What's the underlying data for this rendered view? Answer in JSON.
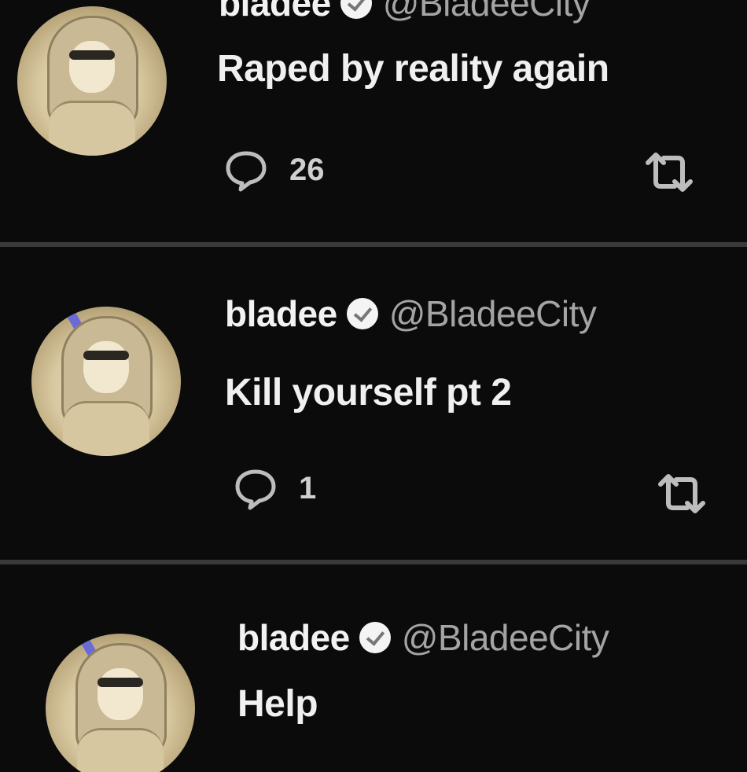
{
  "tweets": [
    {
      "name": "bladee",
      "handle": "@BladeeCity",
      "text": "Raped by reality again",
      "reply_count": "26"
    },
    {
      "name": "bladee",
      "handle": "@BladeeCity",
      "text": "Kill yourself pt 2",
      "reply_count": "1"
    },
    {
      "name": "bladee",
      "handle": "@BladeeCity",
      "text": "Help"
    }
  ],
  "icons": {
    "verified": "verified-badge-icon",
    "reply": "reply-icon",
    "retweet": "retweet-icon"
  },
  "colors": {
    "background": "#0b0b0b",
    "divider": "#3a3a3a",
    "text": "#f0f0f0",
    "handle": "#a4a4a4"
  }
}
